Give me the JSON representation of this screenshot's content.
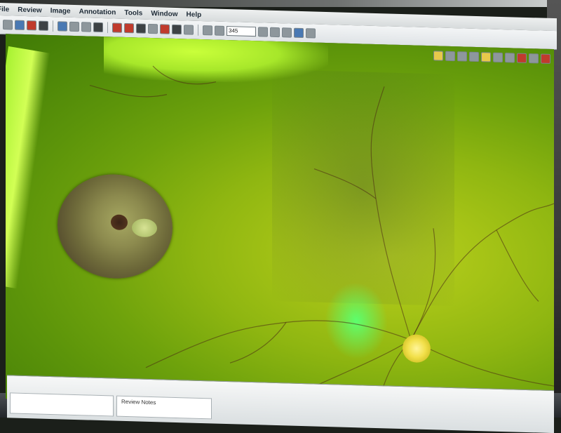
{
  "menubar": {
    "items": [
      "File",
      "Review",
      "Image",
      "Annotation",
      "Tools",
      "Window",
      "Help"
    ]
  },
  "toolbar": {
    "zoom_value": "345",
    "icons": [
      "layout-icon",
      "user-icon",
      "image-red-icon",
      "image-dark-icon",
      "save-icon",
      "brush-icon",
      "print-icon",
      "export-icon",
      "grid-icon",
      "zoom-in-icon",
      "zoom-out-icon",
      "fit-icon",
      "magnify-icon"
    ]
  },
  "viewer": {
    "colors": {
      "fundus_light": "#b7cf1e",
      "fundus_dark": "#3f7a06",
      "disc": "#f2e04a"
    }
  },
  "bottom_panel": {
    "tabs": [
      "Review Notes"
    ]
  }
}
